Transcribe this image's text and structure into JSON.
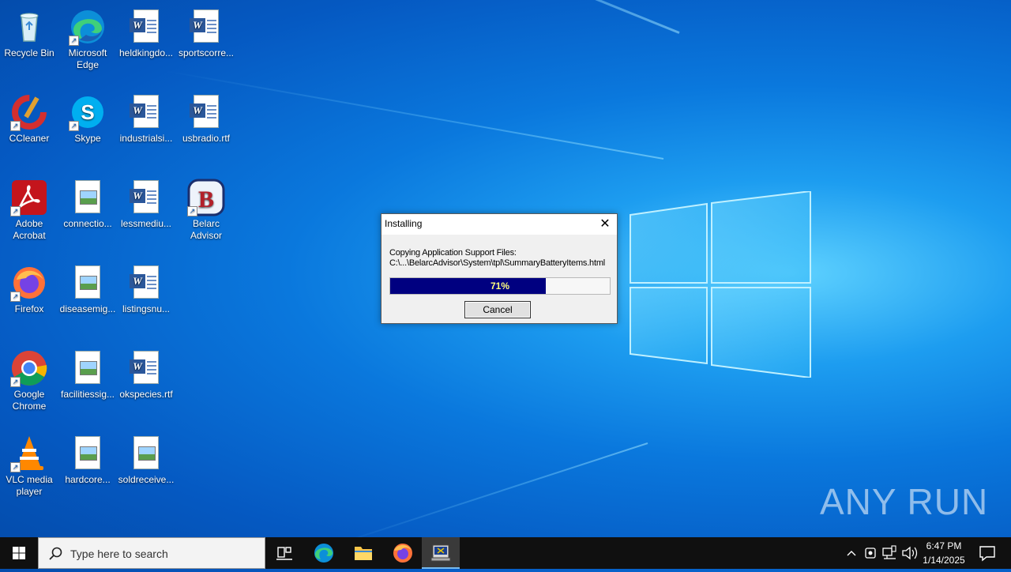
{
  "desktop": {
    "icons": [
      {
        "label": "Recycle Bin"
      },
      {
        "label": "Microsoft Edge"
      },
      {
        "label": "heldkingdo..."
      },
      {
        "label": "sportscorre..."
      },
      {
        "label": "CCleaner"
      },
      {
        "label": "Skype"
      },
      {
        "label": "industrialsi..."
      },
      {
        "label": "usbradio.rtf"
      },
      {
        "label": "Adobe Acrobat"
      },
      {
        "label": "connectio..."
      },
      {
        "label": "lessmediu..."
      },
      {
        "label": "Belarc Advisor"
      },
      {
        "label": "Firefox"
      },
      {
        "label": "diseasemig..."
      },
      {
        "label": "listingsnu..."
      },
      {
        "label": "Google Chrome"
      },
      {
        "label": "facilitiessig..."
      },
      {
        "label": "okspecies.rtf"
      },
      {
        "label": "VLC media player"
      },
      {
        "label": "hardcore..."
      },
      {
        "label": "soldreceive..."
      }
    ]
  },
  "dialog": {
    "title": "Installing",
    "message_line1": "Copying Application Support Files:",
    "message_line2": "C:\\...\\BelarcAdvisor\\System\\tpl\\SummaryBatteryItems.html",
    "progress_percent": 71,
    "progress_label": "71%",
    "cancel_label": "Cancel"
  },
  "taskbar": {
    "search_placeholder": "Type here to search",
    "time": "6:47 PM",
    "date": "1/14/2025"
  },
  "watermark": "ANY RUN",
  "colors": {
    "progress_fill": "#000080",
    "taskbar_bg": "#101010",
    "word_blue": "#2b579a"
  }
}
